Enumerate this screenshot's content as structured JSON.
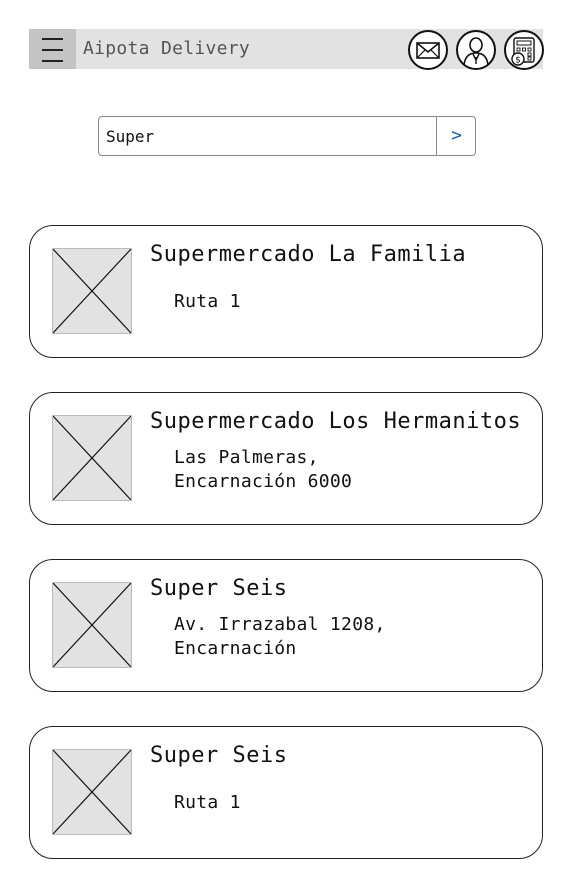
{
  "header": {
    "title": "Aipota Delivery",
    "menu_icon": "hamburger-menu-icon",
    "icons": [
      "mail-icon",
      "profile-icon",
      "calculator-icon"
    ]
  },
  "search": {
    "value": "Super",
    "button_label": ">"
  },
  "stores": [
    {
      "name": "Supermercado La Familia",
      "address_lines": [
        "Ruta 1"
      ]
    },
    {
      "name": "Supermercado Los Hermanitos",
      "address_lines": [
        "Las Palmeras,",
        "Encarnación 6000"
      ]
    },
    {
      "name": "Super Seis",
      "address_lines": [
        "Av. Irrazabal 1208,",
        "Encarnación"
      ]
    },
    {
      "name": "Super Seis",
      "address_lines": [
        "Ruta 1"
      ]
    }
  ],
  "colors": {
    "header_bg": "#e2e2e2",
    "menu_bg": "#c4c4c4",
    "accent": "#1a5fb4",
    "placeholder_image": "#e2e2e2"
  }
}
